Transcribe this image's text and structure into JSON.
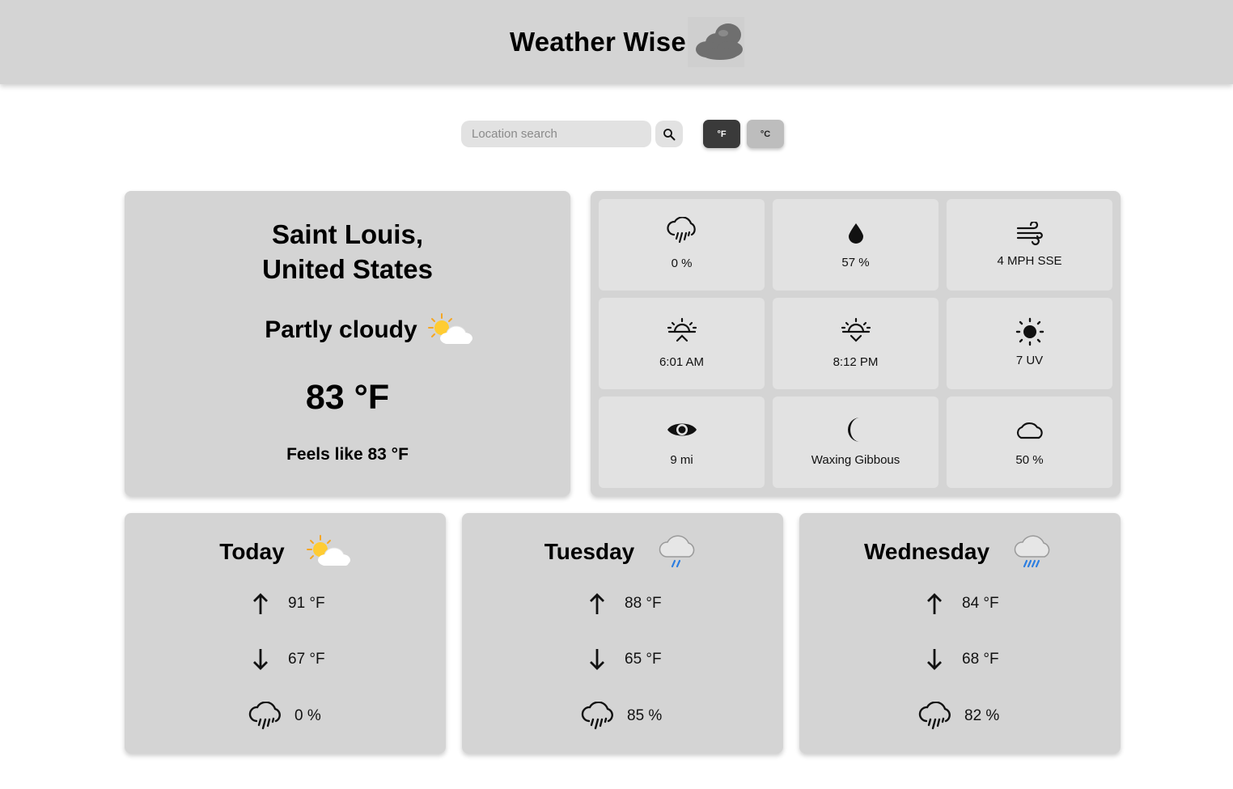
{
  "header": {
    "title": "Weather Wise",
    "logo_icon": "clouds-logo-icon"
  },
  "search": {
    "placeholder": "Location search",
    "value": "",
    "button_icon": "search-icon"
  },
  "units": {
    "fahrenheit_label": "°F",
    "celsius_label": "°C",
    "selected": "°F"
  },
  "current": {
    "location_line1": "Saint Louis,",
    "location_line2": "United States",
    "condition": "Partly cloudy",
    "condition_icon": "partly-cloudy-icon",
    "temperature": "83 °F",
    "feels_like": "Feels like 83 °F"
  },
  "details": [
    {
      "icon": "rain-chance-icon",
      "value": "0 %"
    },
    {
      "icon": "humidity-drop-icon",
      "value": "57 %"
    },
    {
      "icon": "wind-icon",
      "value": "4 MPH SSE"
    },
    {
      "icon": "sunrise-icon",
      "value": "6:01 AM"
    },
    {
      "icon": "sunset-icon",
      "value": "8:12 PM"
    },
    {
      "icon": "uv-sun-icon",
      "value": "7 UV"
    },
    {
      "icon": "visibility-eye-icon",
      "value": "9 mi"
    },
    {
      "icon": "moon-phase-icon",
      "value": "Waxing Gibbous"
    },
    {
      "icon": "cloud-cover-icon",
      "value": "50 %"
    }
  ],
  "forecast": [
    {
      "day": "Today",
      "icon": "partly-cloudy-icon",
      "high": "91 °F",
      "low": "67 °F",
      "rain": "0 %"
    },
    {
      "day": "Tuesday",
      "icon": "light-rain-icon",
      "high": "88 °F",
      "low": "65 °F",
      "rain": "85 %"
    },
    {
      "day": "Wednesday",
      "icon": "heavy-rain-icon",
      "high": "84 °F",
      "low": "68 °F",
      "rain": "82 %"
    }
  ]
}
